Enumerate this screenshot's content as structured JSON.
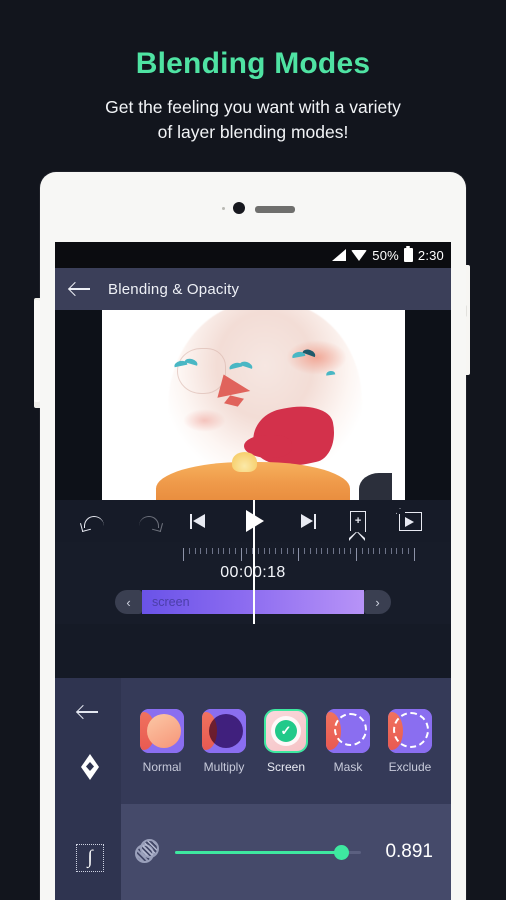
{
  "promo": {
    "title": "Blending Modes",
    "subtitle_line1": "Get the feeling you want with a variety",
    "subtitle_line2": "of layer blending modes!",
    "title_color": "#4fe3a3",
    "background_color": "#12151d"
  },
  "status_bar": {
    "battery_percent": "50%",
    "time": "2:30",
    "icons": [
      "signal-icon",
      "wifi-icon",
      "battery-icon"
    ]
  },
  "app_bar": {
    "back_icon": "arrow-left-icon",
    "title": "Blending & Opacity",
    "background_color": "#3b3f59"
  },
  "preview": {
    "description": "double-exposure portrait with birds, red arrow and sunset band"
  },
  "transport": {
    "buttons": [
      {
        "name": "undo-button",
        "icon": "undo-icon",
        "label": "Undo",
        "enabled": true
      },
      {
        "name": "redo-button",
        "icon": "redo-icon",
        "label": "Redo",
        "enabled": false
      },
      {
        "name": "jump-start-button",
        "icon": "skip-to-start-icon",
        "label": "Jump to start",
        "enabled": true
      },
      {
        "name": "play-button",
        "icon": "play-icon",
        "label": "Play",
        "enabled": true
      },
      {
        "name": "jump-end-button",
        "icon": "skip-to-end-icon",
        "label": "Jump to end",
        "enabled": true
      },
      {
        "name": "bookmark-button",
        "icon": "bookmark-add-icon",
        "label": "Add bookmark",
        "enabled": true
      },
      {
        "name": "loop-button",
        "icon": "loop-export-icon",
        "label": "Loop",
        "enabled": true
      }
    ]
  },
  "timeline": {
    "timecode": "00:00:18",
    "prev_chip": "‹",
    "next_chip": "›",
    "clip_label": "screen",
    "clip_color_start": "#6a53e8",
    "clip_color_end": "#b793f7",
    "playhead_color": "#ffffff"
  },
  "side_rail": {
    "back_icon": "arrow-left-icon",
    "keyframe_icon": "keyframe-diamond-icon",
    "curve_icon": "easing-curve-icon"
  },
  "blend_modes": {
    "selected": "Screen",
    "items": [
      {
        "label": "Normal",
        "selected": false,
        "thumb": "blend-thumb-normal"
      },
      {
        "label": "Multiply",
        "selected": false,
        "thumb": "blend-thumb-multiply"
      },
      {
        "label": "Screen",
        "selected": true,
        "thumb": "blend-thumb-screen"
      },
      {
        "label": "Mask",
        "selected": false,
        "thumb": "blend-thumb-mask"
      },
      {
        "label": "Exclude",
        "selected": false,
        "thumb": "blend-thumb-exclude"
      }
    ]
  },
  "opacity": {
    "icon": "opacity-icon",
    "value": "0.891",
    "fill_percent": 89,
    "accent_color": "#3ee8a0"
  }
}
